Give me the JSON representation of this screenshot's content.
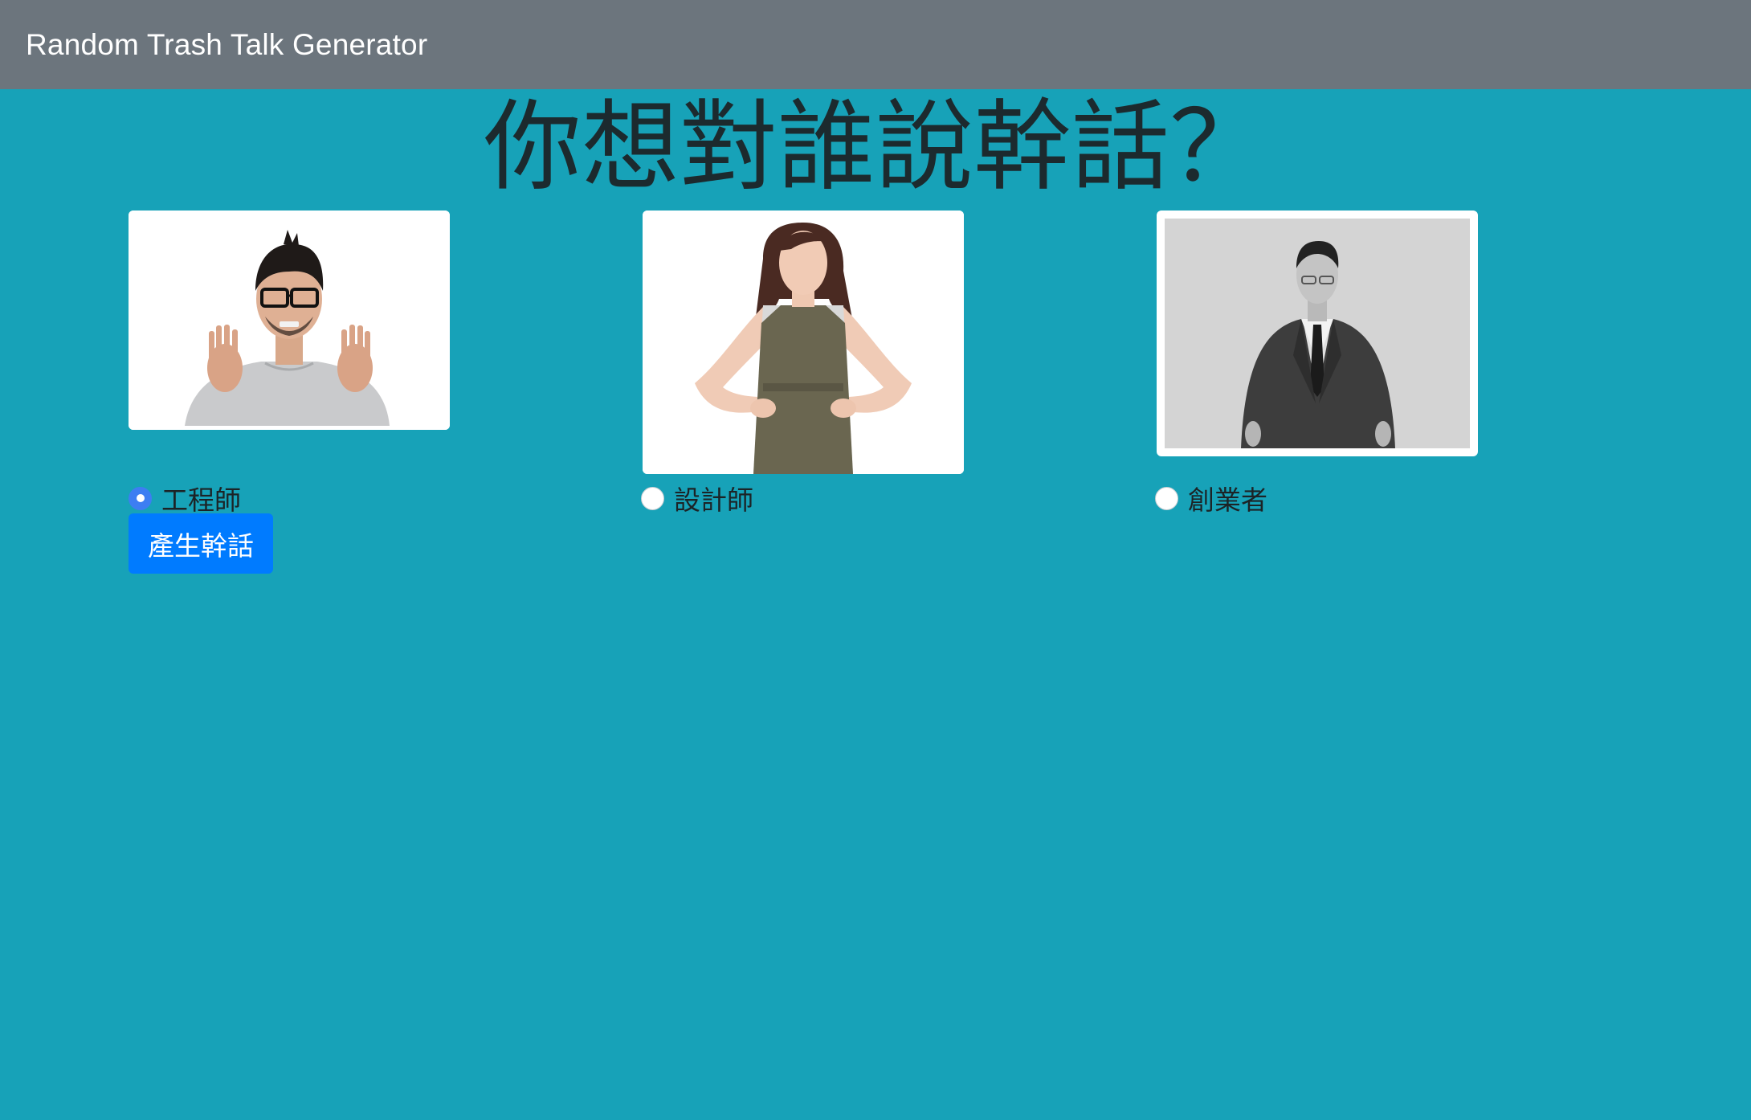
{
  "navbar": {
    "brand": "Random Trash Talk Generator"
  },
  "main": {
    "heading": "你想對誰說幹話？",
    "options": [
      {
        "label": "工程師",
        "checked": true,
        "photo": "engineer-photo"
      },
      {
        "label": "設計師",
        "checked": false,
        "photo": "designer-photo"
      },
      {
        "label": "創業者",
        "checked": false,
        "photo": "entrepreneur-photo"
      }
    ],
    "submit_label": "產生幹話"
  },
  "colors": {
    "background": "#17a2b8",
    "navbar": "#6c757d",
    "button": "#007bff",
    "radio_checked": "#3d7ef2"
  }
}
